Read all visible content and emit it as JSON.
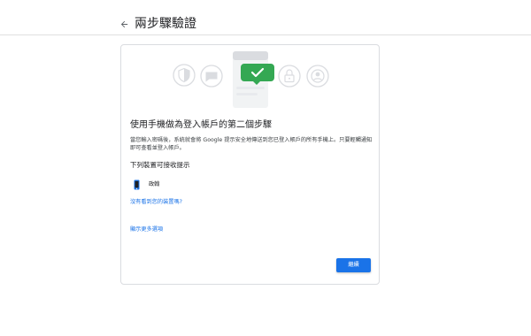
{
  "header": {
    "title": "兩步驟驗證",
    "back_icon": "arrow-back-icon"
  },
  "card": {
    "illustration_icons": [
      "shield-icon",
      "chat-icon",
      "checkmark-icon",
      "lock-icon",
      "person-icon"
    ],
    "heading": "使用手機做為登入帳戶的第二個步驟",
    "description": "當您輸入密碼後，系統就會將 Google 提示安全地傳送到您已登入帳戶的所有手機上。只要輕觸通知即可查看並登入帳戶。",
    "devices_label": "下列裝置可接收提示",
    "device": {
      "icon": "phone-icon",
      "name": "政翰"
    },
    "missing_device_link": "沒有看到您的裝置嗎?",
    "more_options_link": "顯示更多選項",
    "continue_label": "繼續"
  },
  "colors": {
    "accent": "#1a73e8",
    "success": "#34a853",
    "icon_gray": "#dadce0"
  }
}
